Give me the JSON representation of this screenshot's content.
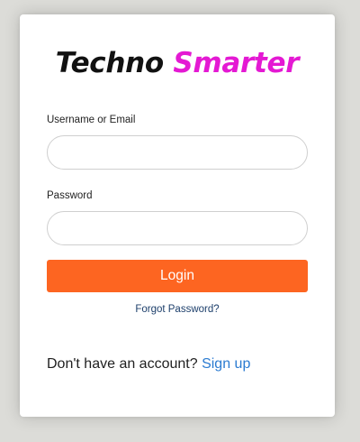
{
  "logo": {
    "word1": "Techno",
    "word2": "Smarter"
  },
  "form": {
    "username_label": "Username or Email",
    "username_value": "",
    "password_label": "Password",
    "password_value": "",
    "login_label": "Login",
    "forgot_label": "Forgot Password?"
  },
  "signup": {
    "prompt": "Don't have an account?",
    "link_label": "Sign up"
  },
  "colors": {
    "background": "#dcdcd8",
    "card": "#ffffff",
    "logo_dark": "#111111",
    "logo_accent": "#e419d3",
    "button": "#fd6521",
    "link": "#2b7bd1",
    "forgot_link": "#1d3f6b"
  }
}
